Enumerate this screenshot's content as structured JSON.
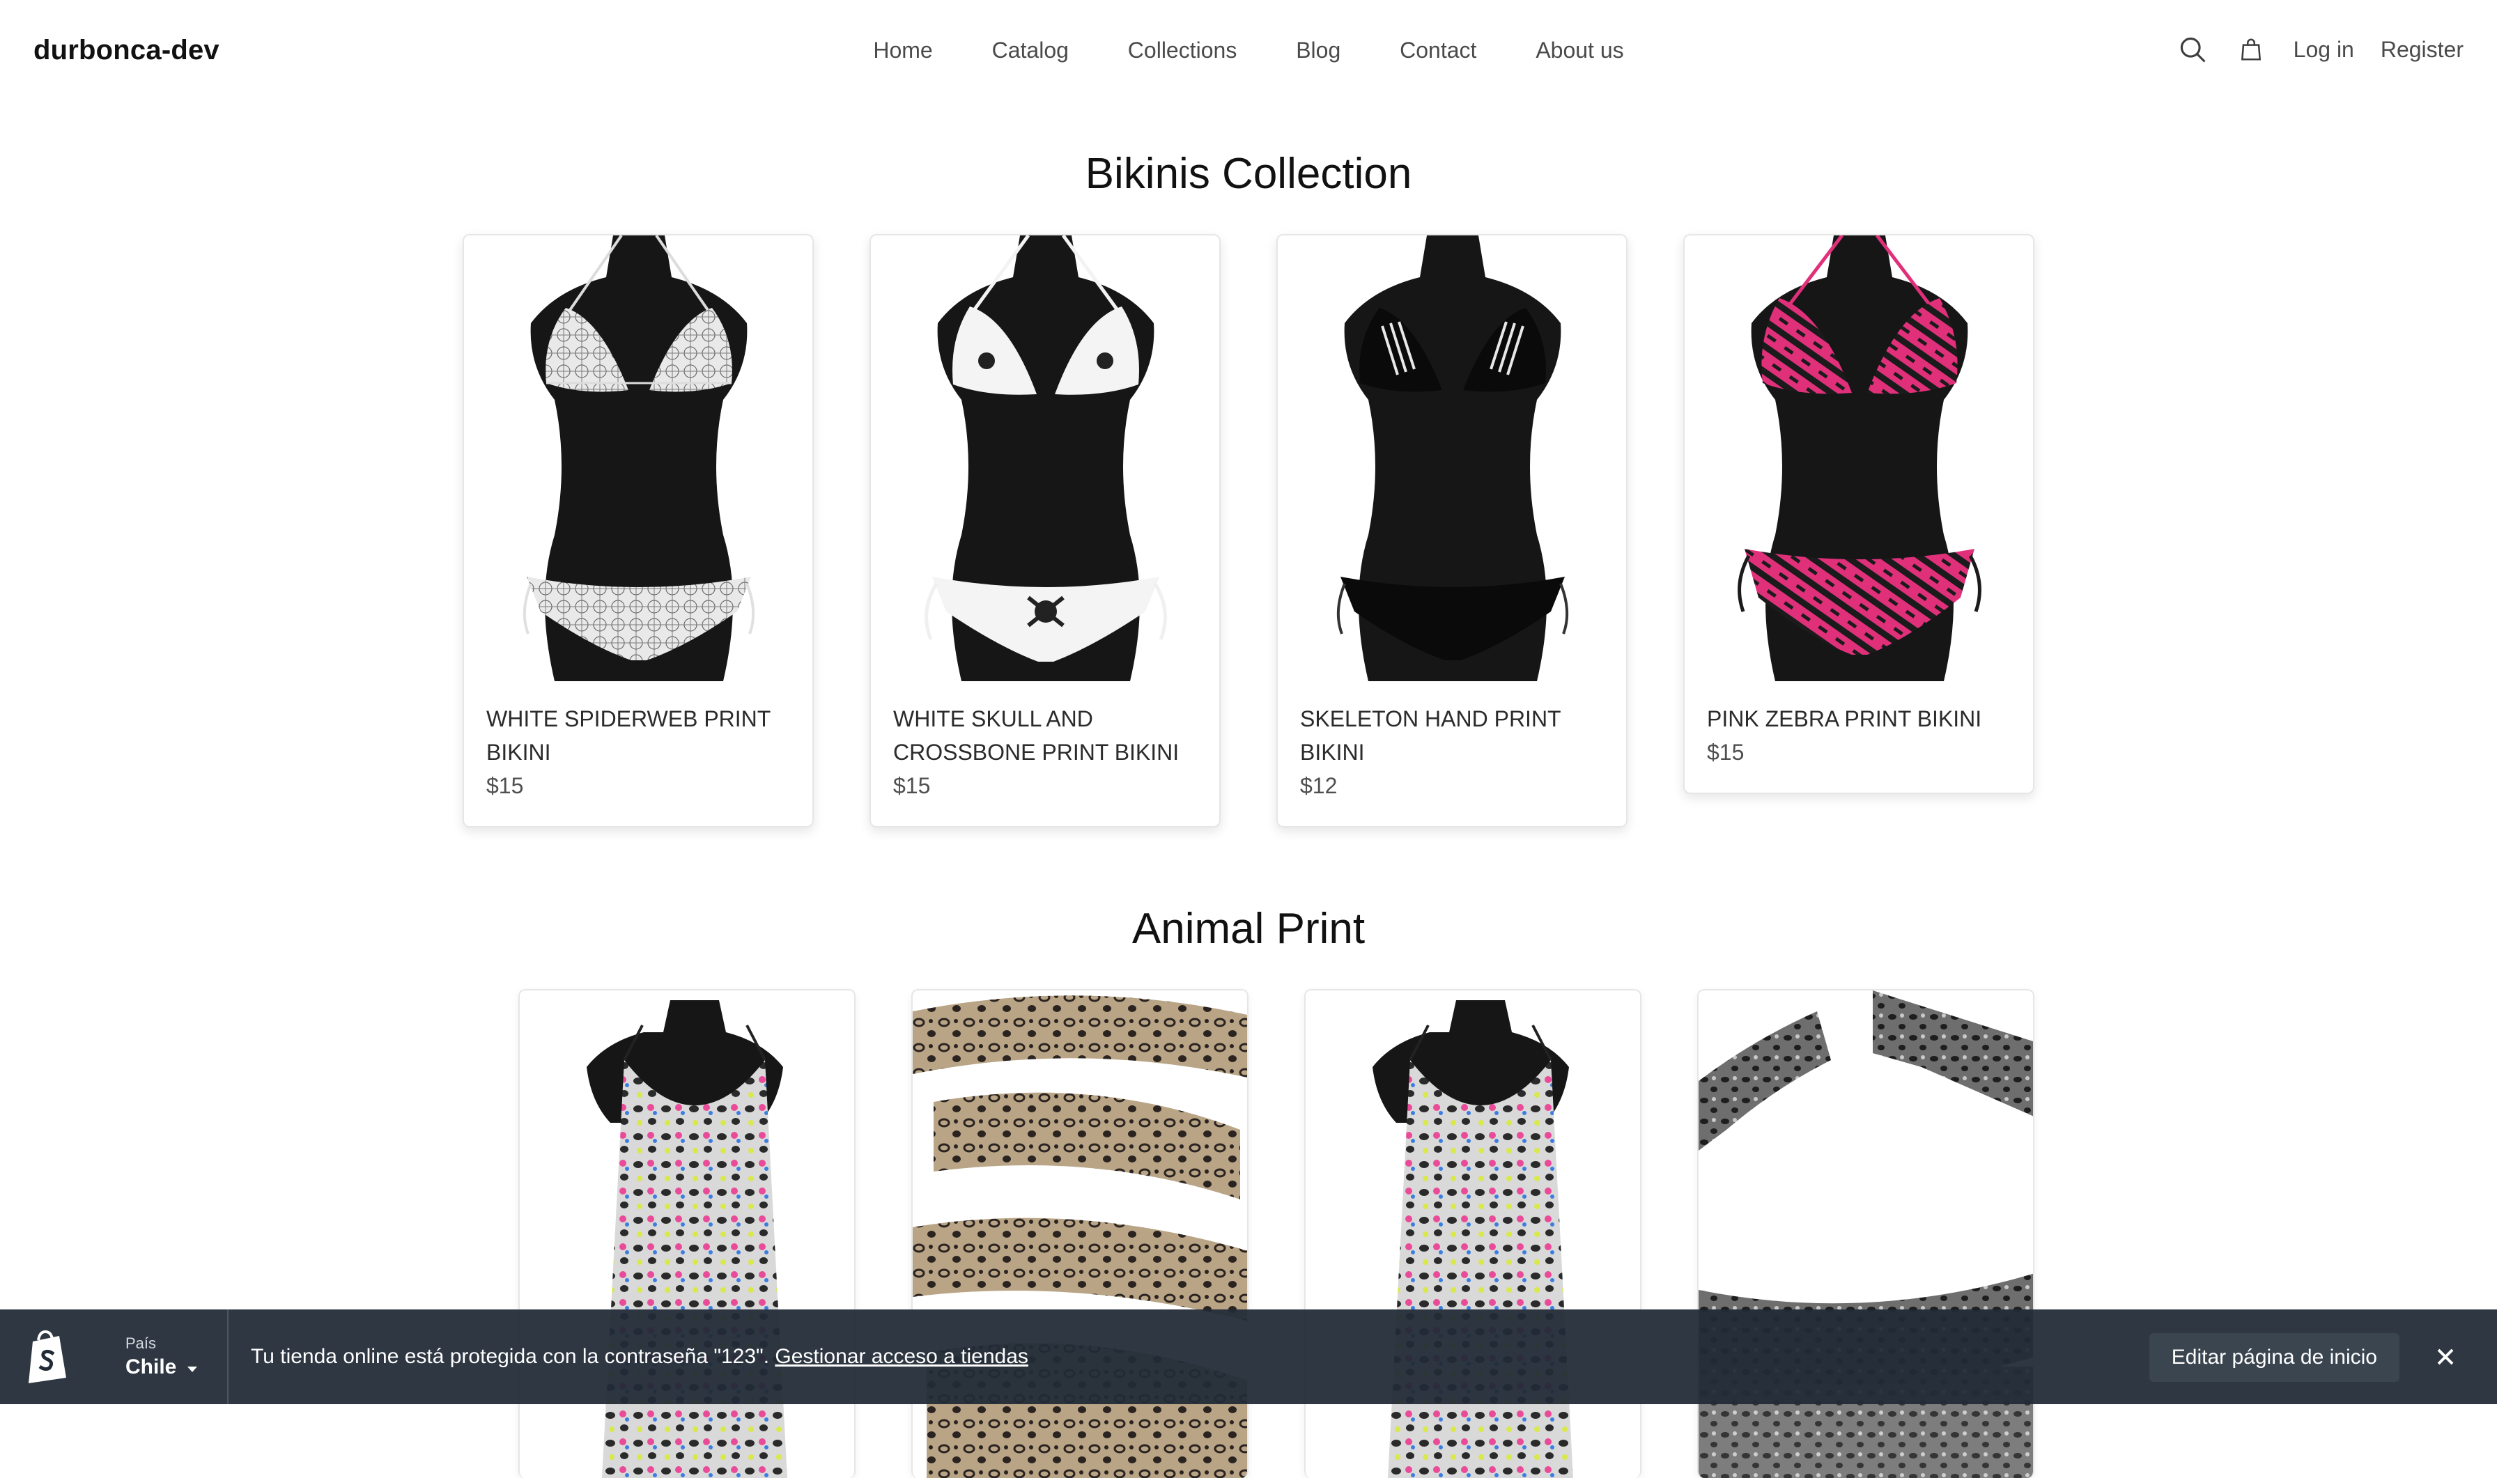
{
  "header": {
    "brand": "durbonca-dev",
    "nav": [
      "Home",
      "Catalog",
      "Collections",
      "Blog",
      "Contact",
      "About us"
    ],
    "search_icon": "search-icon",
    "cart_icon": "shopping-bag-icon",
    "login": "Log in",
    "register": "Register"
  },
  "collections": [
    {
      "title": "Bikinis Collection",
      "products": [
        {
          "title": "WHITE SPIDERWEB PRINT BIKINI",
          "price": "$15",
          "pattern": "white-spiderweb"
        },
        {
          "title": "WHITE SKULL AND CROSSBONE PRINT BIKINI",
          "price": "$15",
          "pattern": "white-skull"
        },
        {
          "title": "SKELETON HAND PRINT BIKINI",
          "price": "$12",
          "pattern": "black-skeleton"
        },
        {
          "title": "PINK ZEBRA PRINT BIKINI",
          "price": "$15",
          "pattern": "pink-zebra"
        }
      ]
    },
    {
      "title": "Animal Print",
      "products": [
        {
          "pattern": "leopard-dress"
        },
        {
          "pattern": "leopard-scarf"
        },
        {
          "pattern": "leopard-dress"
        },
        {
          "pattern": "animal-headband"
        }
      ]
    }
  ],
  "admin_bar": {
    "country_label": "País",
    "country_value": "Chile",
    "notice": "Tu tienda online está protegida con la contraseña \"123\".",
    "notice_link": "Gestionar acceso a tiendas",
    "edit_button": "Editar página de inicio",
    "close_icon": "close-icon"
  },
  "colors": {
    "admin_bar_bg": "#212b36",
    "text_primary": "#111111",
    "text_secondary": "#4a4a4a",
    "bikini_white": "#ececec",
    "bikini_pink": "#e0307a",
    "mannequin": "#161616"
  }
}
